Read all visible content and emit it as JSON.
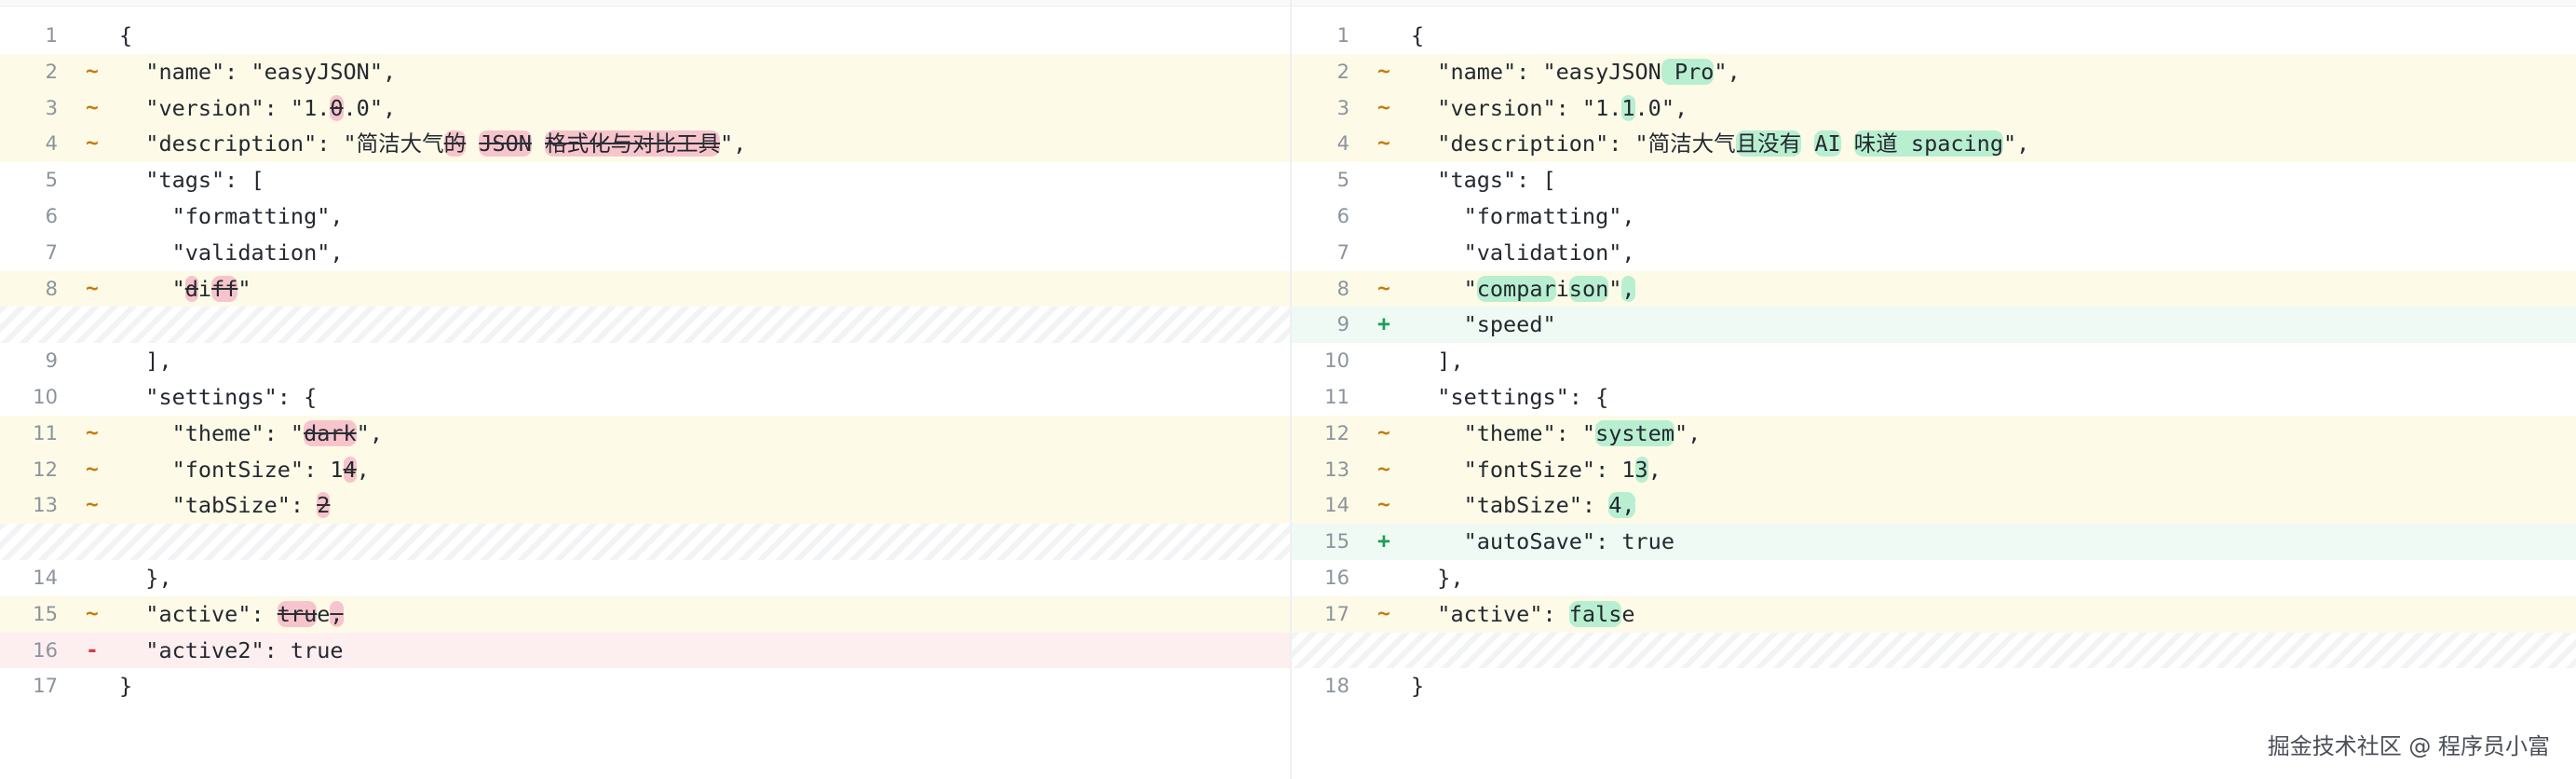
{
  "left_pane": {
    "rows": [
      {
        "type": "ctx",
        "line": "1",
        "marker": "",
        "segments": [
          {
            "t": "{"
          }
        ]
      },
      {
        "type": "mod",
        "line": "2",
        "marker": "~",
        "segments": [
          {
            "t": "  \"name\": \"easyJSON\","
          }
        ]
      },
      {
        "type": "mod",
        "line": "3",
        "marker": "~",
        "segments": [
          {
            "t": "  \"version\": \"1."
          },
          {
            "t": "0",
            "del": true
          },
          {
            "t": ".0\","
          }
        ]
      },
      {
        "type": "mod",
        "line": "4",
        "marker": "~",
        "segments": [
          {
            "t": "  \"description\": \"简洁大气"
          },
          {
            "t": "的",
            "del": true
          },
          {
            "t": " "
          },
          {
            "t": "JSON",
            "del": true
          },
          {
            "t": " "
          },
          {
            "t": "格式化与对比工具",
            "del": true
          },
          {
            "t": "\","
          }
        ]
      },
      {
        "type": "ctx",
        "line": "5",
        "marker": "",
        "segments": [
          {
            "t": "  \"tags\": ["
          }
        ]
      },
      {
        "type": "ctx",
        "line": "6",
        "marker": "",
        "segments": [
          {
            "t": "    \"formatting\","
          }
        ]
      },
      {
        "type": "ctx",
        "line": "7",
        "marker": "",
        "segments": [
          {
            "t": "    \"validation\","
          }
        ]
      },
      {
        "type": "mod",
        "line": "8",
        "marker": "~",
        "segments": [
          {
            "t": "    \""
          },
          {
            "t": "d",
            "del": true
          },
          {
            "t": "i"
          },
          {
            "t": "ff",
            "del": true
          },
          {
            "t": "\""
          }
        ]
      },
      {
        "type": "pad",
        "line": "",
        "marker": "",
        "segments": []
      },
      {
        "type": "ctx",
        "line": "9",
        "marker": "",
        "segments": [
          {
            "t": "  ],"
          }
        ]
      },
      {
        "type": "ctx",
        "line": "10",
        "marker": "",
        "segments": [
          {
            "t": "  \"settings\": {"
          }
        ]
      },
      {
        "type": "mod",
        "line": "11",
        "marker": "~",
        "segments": [
          {
            "t": "    \"theme\": \""
          },
          {
            "t": "dark",
            "del": true
          },
          {
            "t": "\","
          }
        ]
      },
      {
        "type": "mod",
        "line": "12",
        "marker": "~",
        "segments": [
          {
            "t": "    \"fontSize\": 1"
          },
          {
            "t": "4",
            "del": true
          },
          {
            "t": ","
          }
        ]
      },
      {
        "type": "mod",
        "line": "13",
        "marker": "~",
        "segments": [
          {
            "t": "    \"tabSize\": "
          },
          {
            "t": "2",
            "del": true
          }
        ]
      },
      {
        "type": "pad",
        "line": "",
        "marker": "",
        "segments": []
      },
      {
        "type": "ctx",
        "line": "14",
        "marker": "",
        "segments": [
          {
            "t": "  },"
          }
        ]
      },
      {
        "type": "mod",
        "line": "15",
        "marker": "~",
        "segments": [
          {
            "t": "  \"active\": "
          },
          {
            "t": "tru",
            "del": true
          },
          {
            "t": "e"
          },
          {
            "t": ",",
            "del": true
          }
        ]
      },
      {
        "type": "del",
        "line": "16",
        "marker": "-",
        "segments": [
          {
            "t": "  \"active2\": true"
          }
        ]
      },
      {
        "type": "ctx",
        "line": "17",
        "marker": "",
        "segments": [
          {
            "t": "}"
          }
        ]
      }
    ]
  },
  "right_pane": {
    "rows": [
      {
        "type": "ctx",
        "line": "1",
        "marker": "",
        "segments": [
          {
            "t": "{"
          }
        ]
      },
      {
        "type": "mod",
        "line": "2",
        "marker": "~",
        "segments": [
          {
            "t": "  \"name\": \"easyJSON"
          },
          {
            "t": " Pro",
            "add": true
          },
          {
            "t": "\","
          }
        ]
      },
      {
        "type": "mod",
        "line": "3",
        "marker": "~",
        "segments": [
          {
            "t": "  \"version\": \"1."
          },
          {
            "t": "1",
            "add": true
          },
          {
            "t": ".0\","
          }
        ]
      },
      {
        "type": "mod",
        "line": "4",
        "marker": "~",
        "segments": [
          {
            "t": "  \"description\": \"简洁大气"
          },
          {
            "t": "且没有",
            "add": true
          },
          {
            "t": " "
          },
          {
            "t": "AI",
            "add": true
          },
          {
            "t": " "
          },
          {
            "t": "味道 spacing",
            "add": true
          },
          {
            "t": "\","
          }
        ]
      },
      {
        "type": "ctx",
        "line": "5",
        "marker": "",
        "segments": [
          {
            "t": "  \"tags\": ["
          }
        ]
      },
      {
        "type": "ctx",
        "line": "6",
        "marker": "",
        "segments": [
          {
            "t": "    \"formatting\","
          }
        ]
      },
      {
        "type": "ctx",
        "line": "7",
        "marker": "",
        "segments": [
          {
            "t": "    \"validation\","
          }
        ]
      },
      {
        "type": "mod",
        "line": "8",
        "marker": "~",
        "segments": [
          {
            "t": "    \""
          },
          {
            "t": "compar",
            "add": true
          },
          {
            "t": "i"
          },
          {
            "t": "son",
            "add": true
          },
          {
            "t": "\""
          },
          {
            "t": ",",
            "add": true
          }
        ]
      },
      {
        "type": "add",
        "line": "9",
        "marker": "+",
        "segments": [
          {
            "t": "    \"speed\""
          }
        ]
      },
      {
        "type": "ctx",
        "line": "10",
        "marker": "",
        "segments": [
          {
            "t": "  ],"
          }
        ]
      },
      {
        "type": "ctx",
        "line": "11",
        "marker": "",
        "segments": [
          {
            "t": "  \"settings\": {"
          }
        ]
      },
      {
        "type": "mod",
        "line": "12",
        "marker": "~",
        "segments": [
          {
            "t": "    \"theme\": \""
          },
          {
            "t": "system",
            "add": true
          },
          {
            "t": "\","
          }
        ]
      },
      {
        "type": "mod",
        "line": "13",
        "marker": "~",
        "segments": [
          {
            "t": "    \"fontSize\": 1"
          },
          {
            "t": "3",
            "add": true
          },
          {
            "t": ","
          }
        ]
      },
      {
        "type": "mod",
        "line": "14",
        "marker": "~",
        "segments": [
          {
            "t": "    \"tabSize\": "
          },
          {
            "t": "4,",
            "add": true
          }
        ]
      },
      {
        "type": "add",
        "line": "15",
        "marker": "+",
        "segments": [
          {
            "t": "    \"autoSave\": true"
          }
        ]
      },
      {
        "type": "ctx",
        "line": "16",
        "marker": "",
        "segments": [
          {
            "t": "  },"
          }
        ]
      },
      {
        "type": "mod",
        "line": "17",
        "marker": "~",
        "segments": [
          {
            "t": "  \"active\": "
          },
          {
            "t": "fals",
            "add": true
          },
          {
            "t": "e"
          }
        ]
      },
      {
        "type": "pad",
        "line": "",
        "marker": "",
        "segments": []
      },
      {
        "type": "ctx",
        "line": "18",
        "marker": "",
        "segments": [
          {
            "t": "}"
          }
        ]
      }
    ]
  },
  "watermark": "掘金技术社区 @ 程序员小富"
}
